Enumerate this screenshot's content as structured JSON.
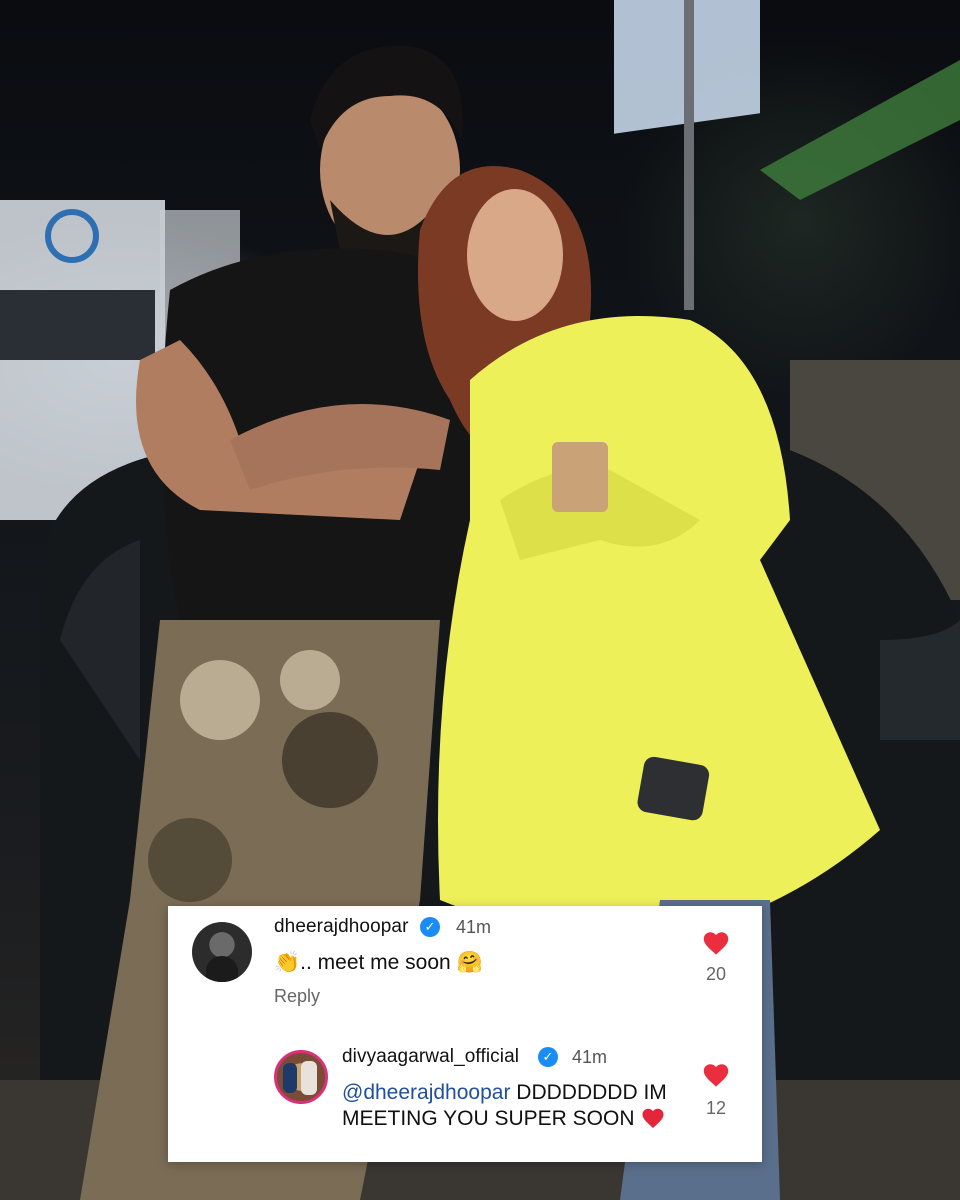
{
  "comments": [
    {
      "username": "dheerajdhoopar",
      "verified": true,
      "time": "41m",
      "emoji_prefix": "👏",
      "text": ".. meet me soon 🤗",
      "reply_label": "Reply",
      "likes": "20",
      "avatar_icon": "profile-photo-icon"
    },
    {
      "username": "divyaagarwal_official",
      "verified": true,
      "time": "41m",
      "mention": "@dheerajdhoopar",
      "text_after_mention": " DDDDDDDD IM MEETING YOU SUPER SOON",
      "trailing_icon": "red-heart-icon",
      "likes": "12",
      "avatar_icon": "profile-photo-icon"
    }
  ],
  "colors": {
    "like": "#ea2e3e",
    "verified": "#1a8cf5",
    "mention": "#1f4f9e",
    "card": "#ffffff"
  },
  "background_photo": {
    "subject": "photo-background"
  }
}
